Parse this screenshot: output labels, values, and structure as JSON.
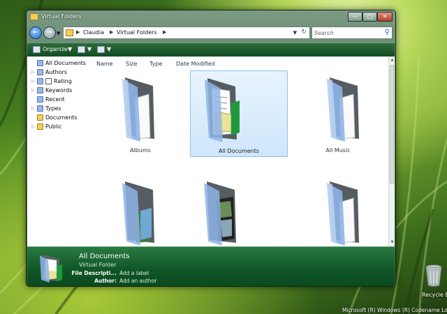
{
  "window": {
    "title": "Virtual Folders",
    "buttons": {
      "minimize": "—",
      "maximize": "□",
      "close": "✕"
    }
  },
  "address": {
    "crumbs": [
      "Claudia",
      "Virtual Folders"
    ],
    "search_placeholder": "Search"
  },
  "toolbar": {
    "organize": "Organize"
  },
  "nav": {
    "items": [
      {
        "label": "All Documents",
        "icon": "virtual-folder-icon"
      },
      {
        "label": "Authors",
        "icon": "virtual-folder-icon"
      },
      {
        "label": "Rating",
        "icon": "rating-icon"
      },
      {
        "label": "Keywords",
        "icon": "virtual-folder-icon"
      },
      {
        "label": "Recent",
        "icon": "virtual-folder-icon"
      },
      {
        "label": "Types",
        "icon": "virtual-folder-icon"
      },
      {
        "label": "Documents",
        "icon": "folder-icon"
      },
      {
        "label": "Public",
        "icon": "folder-icon"
      }
    ]
  },
  "columns": [
    "Name",
    "Size",
    "Type",
    "Date Modified"
  ],
  "folders": [
    {
      "label": "Albums",
      "selected": false
    },
    {
      "label": "All Documents",
      "selected": true
    },
    {
      "label": "All Music",
      "selected": false
    },
    {
      "label": "",
      "selected": false
    },
    {
      "label": "",
      "selected": false
    },
    {
      "label": "",
      "selected": false
    }
  ],
  "details": {
    "title": "All Documents",
    "type": "Virtual Folder",
    "fields": [
      {
        "key": "File Descripti...",
        "value": "Add a label"
      },
      {
        "key": "Author:",
        "value": "Add an author"
      }
    ]
  },
  "desktop": {
    "recycle_label": "Recycle Bin",
    "watermark": "Microsoft (R) Windows (R) Codename Longhorn"
  },
  "colors": {
    "chrome_green": "#114d23",
    "selection_blue": "#cfe6fb",
    "folder_blue": "#8fb4e8"
  }
}
